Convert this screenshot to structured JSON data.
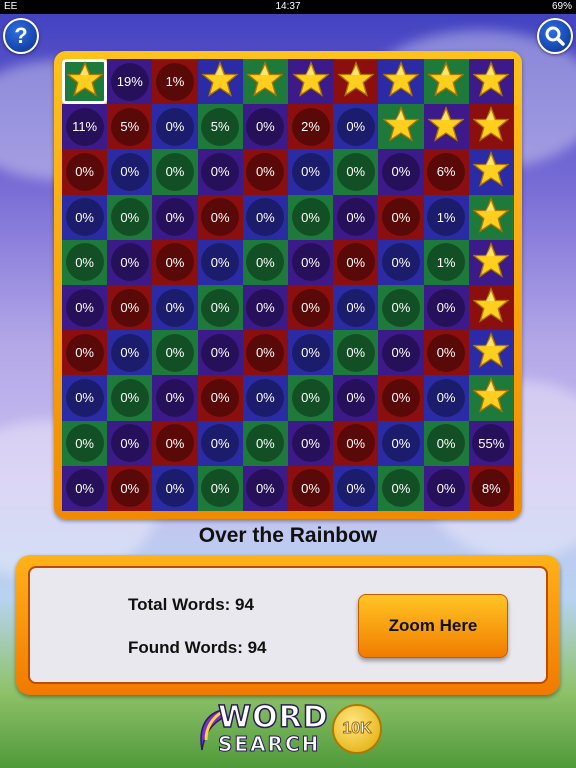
{
  "status_bar": {
    "carrier": "EE",
    "time": "14:37",
    "battery": "69%"
  },
  "toolbar": {
    "help_label": "?",
    "help_icon": "help-icon",
    "search_icon": "search-icon"
  },
  "board": {
    "cells": [
      [
        "★",
        "19%",
        "1%",
        "★",
        "★",
        "★",
        "★",
        "★",
        "★",
        "★"
      ],
      [
        "11%",
        "5%",
        "0%",
        "5%",
        "0%",
        "2%",
        "0%",
        "★",
        "★",
        "★"
      ],
      [
        "0%",
        "0%",
        "0%",
        "0%",
        "0%",
        "0%",
        "0%",
        "0%",
        "6%",
        "★"
      ],
      [
        "0%",
        "0%",
        "0%",
        "0%",
        "0%",
        "0%",
        "0%",
        "0%",
        "1%",
        "★"
      ],
      [
        "0%",
        "0%",
        "0%",
        "0%",
        "0%",
        "0%",
        "0%",
        "0%",
        "1%",
        "★"
      ],
      [
        "0%",
        "0%",
        "0%",
        "0%",
        "0%",
        "0%",
        "0%",
        "0%",
        "0%",
        "★"
      ],
      [
        "0%",
        "0%",
        "0%",
        "0%",
        "0%",
        "0%",
        "0%",
        "0%",
        "0%",
        "★"
      ],
      [
        "0%",
        "0%",
        "0%",
        "0%",
        "0%",
        "0%",
        "0%",
        "0%",
        "0%",
        "★"
      ],
      [
        "0%",
        "0%",
        "0%",
        "0%",
        "0%",
        "0%",
        "0%",
        "0%",
        "0%",
        "55%"
      ],
      [
        "0%",
        "0%",
        "0%",
        "0%",
        "0%",
        "0%",
        "0%",
        "0%",
        "0%",
        "8%"
      ]
    ]
  },
  "puzzle_title": "Over the Rainbow",
  "stats": {
    "total_label": "Total Words: 94",
    "found_label": "Found Words: 94"
  },
  "zoom_button": "Zoom Here",
  "logo": {
    "word": "WORD",
    "search": "SEARCH",
    "badge": "10K"
  }
}
